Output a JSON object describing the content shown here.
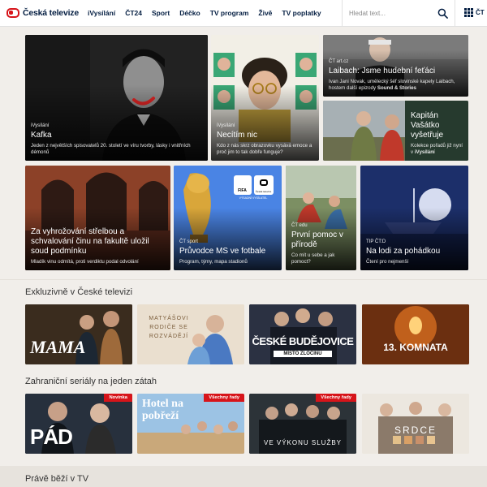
{
  "brand": {
    "name": "Česká televize",
    "accent": "#d7141a",
    "navy": "#041e42"
  },
  "nav": [
    "iVysílání",
    "ČT24",
    "Sport",
    "Déčko",
    "TV program",
    "Živě",
    "TV poplatky"
  ],
  "search": {
    "placeholder": "Hledat text...",
    "icon": "search-icon"
  },
  "menu": {
    "label": "ČT",
    "icon": "grid-icon"
  },
  "hero": {
    "kafka": {
      "tag": "iVysílání",
      "title": "Kafka",
      "desc": "Jeden z největších spisovatelů 20. století ve víru tvorby, lásky i vnitřních démonů"
    },
    "necitim": {
      "tag": "iVysílání",
      "title": "Necítím nic",
      "desc": "Kdo z nás skrz obrazovku vysává emoce a proč jim to tak dobře funguje?"
    },
    "laibach": {
      "tag": "ČT art.cz",
      "title": "Laibach: Jsme hudební feťáci",
      "desc": "Ivan Jani Novak, umělecký šéf slovinské kapely Laibach, hostem další epizody ",
      "desc_bold": "Sound & Stories"
    },
    "vasatko": {
      "title": "Kapitán Vašátko vyšetřuje",
      "desc": "Kolekce pořadů již nyní v ",
      "desc_bold": "iVysílání"
    },
    "vyhrozovani": {
      "title": "Za vyhrožování střelbou a schvalování činu na fakultě uložil soud podmínku",
      "desc": "Mladík vinu odmítá, proti verdiktu podal odvolání"
    },
    "ms": {
      "tag": "ČT sport",
      "title": "Průvodce MS ve fotbale",
      "desc": "Program, týmy, mapa stadionů",
      "logo1": "FIFA",
      "logo2": "Česká televize",
      "logo_caption": "VÝSADNÍ VYSÍLATEL"
    },
    "prvnipomoc": {
      "tag": "ČT edu",
      "title": "První pomoc v přírodě",
      "desc": "Co mít u sebe a jak pomoct?"
    },
    "lodi": {
      "tag": "TIP ČT:D",
      "title": "Na lodi za pohádkou",
      "desc": "Čtení pro nejmenší"
    }
  },
  "sections": {
    "exclusive": {
      "title": "Exkluzivně v České televizi",
      "items": [
        {
          "title": "MAMA"
        },
        {
          "title": "MATYÁŠOVI RODIČE SE ROZVÁDĚJÍ"
        },
        {
          "title": "ČESKÉ BUDĚJOVICE",
          "subtitle": "MÍSTO ZLOČINU"
        },
        {
          "title": "13. KOMNATA"
        }
      ]
    },
    "foreign": {
      "title": "Zahraniční seriály na jeden zátah",
      "items": [
        {
          "title": "PÁD",
          "badge": "Novinka"
        },
        {
          "title": "Hotel na pobřeží",
          "badge": "Všechny řady"
        },
        {
          "title": "VE VÝKONU SLUŽBY",
          "badge": "Všechny řady"
        },
        {
          "title": "SRDCE"
        }
      ]
    },
    "now": {
      "title": "Právě běží v TV"
    }
  }
}
